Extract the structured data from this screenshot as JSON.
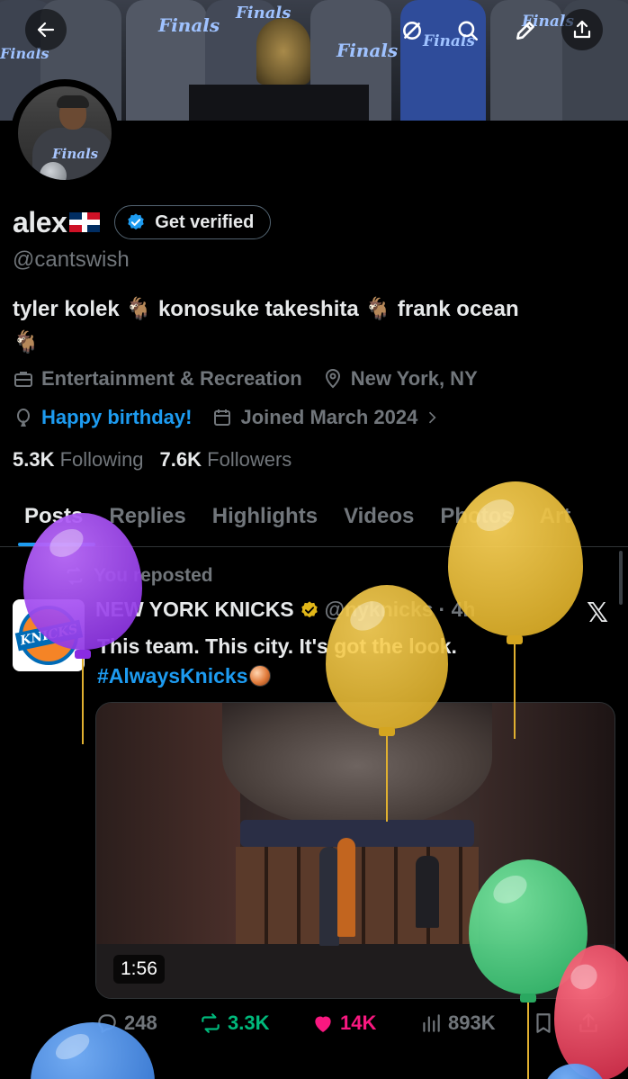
{
  "banner": {
    "shirt_text": "Finals"
  },
  "header_icons": {
    "back": "arrow-left-icon",
    "grok": "grok-icon",
    "search": "search-icon",
    "edit": "pencil-icon",
    "share": "share-icon"
  },
  "profile": {
    "name": "alex",
    "flag": "dominican-republic-flag-icon",
    "verify_label": "Get verified",
    "handle": "@cantswish",
    "bio_line1": "tyler kolek 🐐 konosuke takeshita 🐐 frank ocean",
    "bio_line2": "🐐",
    "category": "Entertainment & Recreation",
    "location": "New York, NY",
    "birthday": "Happy birthday!",
    "joined": "Joined March 2024",
    "following_count": "5.3K",
    "following_label": "Following",
    "followers_count": "7.6K",
    "followers_label": "Followers"
  },
  "tabs": [
    "Posts",
    "Replies",
    "Highlights",
    "Videos",
    "Photos",
    "Articles"
  ],
  "tabs_visible": [
    "Posts",
    "Replies",
    "Highlights",
    "Videos",
    "Photos",
    "Art"
  ],
  "post": {
    "repost_label": "You reposted",
    "author_name": "NEW YORK KNICKS",
    "author_handle": "@nyknicks",
    "time": "· 4h",
    "text_line1": "This team. This city. It's got the look.",
    "hashtag": "#AlwaysKnicks",
    "video_duration": "1:56",
    "replies": "248",
    "reposts": "3.3K",
    "likes": "14K",
    "views": "893K"
  },
  "colors": {
    "accent": "#1d9bf0",
    "repost_green": "#00ba7c",
    "like_pink": "#f91880",
    "muted": "#71767b"
  },
  "balloons": [
    "purple",
    "yellow",
    "yellow",
    "green",
    "red",
    "blue",
    "blue"
  ]
}
